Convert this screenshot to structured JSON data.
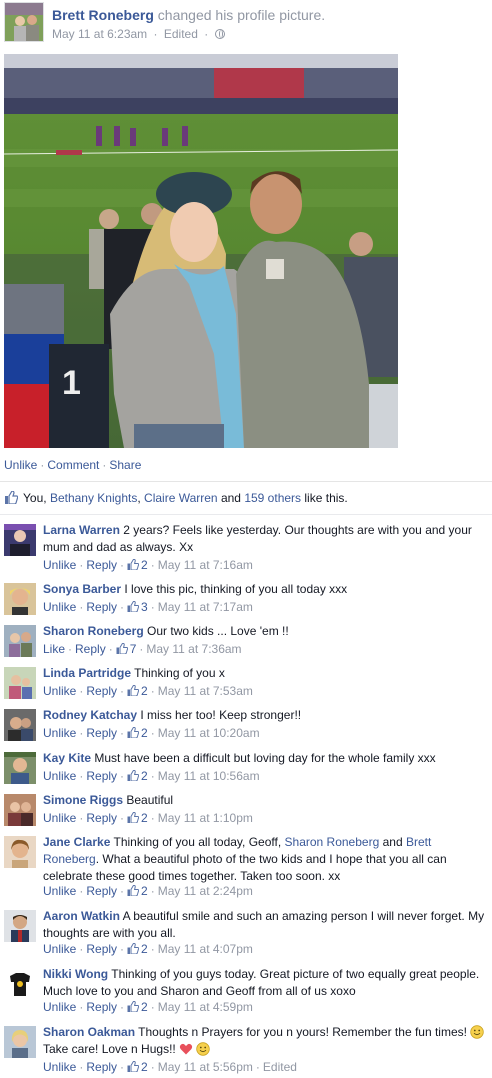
{
  "post": {
    "author": "Brett Roneberg",
    "action": "changed his profile picture.",
    "timestamp": "May 11 at 6:23am",
    "edited": "Edited",
    "privacy_icon": "globe-icon"
  },
  "actions": {
    "unlike": "Unlike",
    "comment": "Comment",
    "share": "Share",
    "sep": "·"
  },
  "likes": {
    "you": "You,",
    "name1": "Bethany Knights",
    "comma": ",",
    "name2": "Claire Warren",
    "and": "and",
    "others": "159 others",
    "suffix": "like this."
  },
  "comments": [
    {
      "author": "Larna Warren",
      "text": "2 years? Feels like yesterday. Our thoughts are with you and your mum and dad as always. Xx",
      "like_label": "Unlike",
      "reply_label": "Reply",
      "likes": "2",
      "time": "May 11 at 7:16am"
    },
    {
      "author": "Sonya Barber",
      "text": "I love this pic, thinking of you all today xxx",
      "like_label": "Unlike",
      "reply_label": "Reply",
      "likes": "3",
      "time": "May 11 at 7:17am"
    },
    {
      "author": "Sharon Roneberg",
      "text": "Our two kids ... Love 'em !!",
      "like_label": "Like",
      "reply_label": "Reply",
      "likes": "7",
      "time": "May 11 at 7:36am"
    },
    {
      "author": "Linda Partridge",
      "text": "Thinking of you x",
      "like_label": "Unlike",
      "reply_label": "Reply",
      "likes": "2",
      "time": "May 11 at 7:53am"
    },
    {
      "author": "Rodney Katchay",
      "text": "I miss her too! Keep stronger!!",
      "like_label": "Unlike",
      "reply_label": "Reply",
      "likes": "2",
      "time": "May 11 at 10:20am"
    },
    {
      "author": "Kay Kite",
      "text": "Must have been a difficult but loving day for the whole family xxx",
      "like_label": "Unlike",
      "reply_label": "Reply",
      "likes": "2",
      "time": "May 11 at 10:56am"
    },
    {
      "author": "Simone Riggs",
      "text": "Beautiful",
      "like_label": "Unlike",
      "reply_label": "Reply",
      "likes": "2",
      "time": "May 11 at 1:10pm"
    },
    {
      "author": "Jane Clarke",
      "text_a": "Thinking of you all today, Geoff,",
      "mention1": "Sharon Roneberg",
      "text_b": "and",
      "mention2": "Brett Roneberg",
      "text_c": ". What a beautiful photo of the two kids and I hope that you all can celebrate these good times together. Taken too soon. xx",
      "like_label": "Unlike",
      "reply_label": "Reply",
      "likes": "2",
      "time": "May 11 at 2:24pm"
    },
    {
      "author": "Aaron Watkin",
      "text": "A beautiful smile and such an amazing person I will never forget. My thoughts are with you all.",
      "like_label": "Unlike",
      "reply_label": "Reply",
      "likes": "2",
      "time": "May 11 at 4:07pm"
    },
    {
      "author": "Nikki Wong",
      "text": "Thinking of you guys today. Great picture of two equally great people. Much love to you and Sharon and Geoff from all of us xoxo",
      "like_label": "Unlike",
      "reply_label": "Reply",
      "likes": "2",
      "time": "May 11 at 4:59pm"
    },
    {
      "author": "Sharon Oakman",
      "text_a": "Thoughts n Prayers for you n yours! Remember the fun times!",
      "text_b": "Take care! Love n Hugs!!",
      "like_label": "Unlike",
      "reply_label": "Reply",
      "likes": "2",
      "time": "May 11 at 5:56pm",
      "edited": "Edited"
    }
  ],
  "colors": {
    "link": "#3b5998",
    "muted": "#9197a3",
    "text": "#141823"
  }
}
